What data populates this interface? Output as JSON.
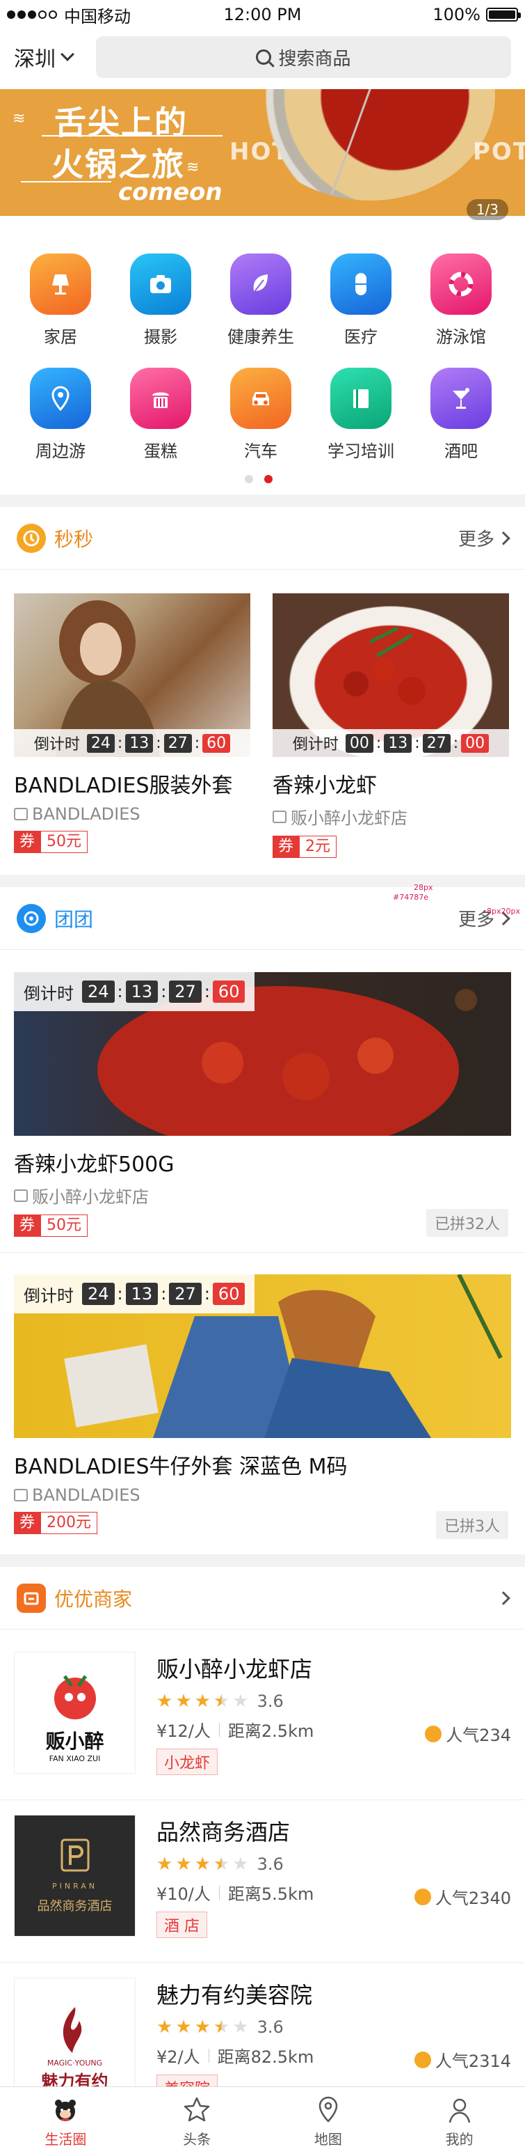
{
  "status_bar": {
    "carrier": "中国移动",
    "time": "12:00 PM",
    "battery": "100%"
  },
  "header": {
    "city": "深圳",
    "search_placeholder": "搜索商品"
  },
  "banner": {
    "line1": "舌尖上的",
    "line2": "火锅之旅",
    "line3": "comeon",
    "bg_left": "HOT",
    "bg_right": "POT",
    "pager": "1/3"
  },
  "categories": [
    {
      "label": "家居",
      "icon": "lamp-icon",
      "color": "#f7941d"
    },
    {
      "label": "摄影",
      "icon": "camera-icon",
      "color": "#1ca0e0"
    },
    {
      "label": "健康养生",
      "icon": "leaf-icon",
      "color": "#8a5cf0"
    },
    {
      "label": "医疗",
      "icon": "capsule-icon",
      "color": "#1e8ff0"
    },
    {
      "label": "游泳馆",
      "icon": "lifebuoy-icon",
      "color": "#ef3f86"
    },
    {
      "label": "周边游",
      "icon": "location-pin-icon",
      "color": "#1e8ff0"
    },
    {
      "label": "蛋糕",
      "icon": "cake-icon",
      "color": "#ef3f86"
    },
    {
      "label": "汽车",
      "icon": "car-icon",
      "color": "#f7941d"
    },
    {
      "label": "学习培训",
      "icon": "book-icon",
      "color": "#14c08c"
    },
    {
      "label": "酒吧",
      "icon": "cocktail-icon",
      "color": "#8a5cf0"
    }
  ],
  "flash_sale": {
    "title": "秒秒",
    "more": "更多",
    "items": [
      {
        "countdown_label": "倒计时",
        "h": "24",
        "m": "13",
        "s": "27",
        "ms": "60",
        "title": "BANDLADIES服装外套",
        "shop": "BANDLADIES",
        "coupon_tag": "券",
        "coupon": "50元"
      },
      {
        "countdown_label": "倒计时",
        "h": "00",
        "m": "13",
        "s": "27",
        "ms": "00",
        "title": "香辣小龙虾",
        "shop": "贩小醉小龙虾店",
        "coupon_tag": "券",
        "coupon": "2元"
      }
    ]
  },
  "annotation": {
    "a": "28px",
    "b": "#74787e",
    "c": "8px20px"
  },
  "group_buy": {
    "title": "团团",
    "more": "更多",
    "items": [
      {
        "countdown_label": "倒计时",
        "h": "24",
        "m": "13",
        "s": "27",
        "ms": "60",
        "title": "香辣小龙虾500G",
        "shop": "贩小醉小龙虾店",
        "coupon_tag": "券",
        "coupon": "50元",
        "joined": "已拼32人"
      },
      {
        "countdown_label": "倒计时",
        "h": "24",
        "m": "13",
        "s": "27",
        "ms": "60",
        "title": "BANDLADIES牛仔外套 深蓝色 M码",
        "shop": "BANDLADIES",
        "coupon_tag": "券",
        "coupon": "200元",
        "joined": "已拼3人"
      }
    ]
  },
  "merchants": {
    "title": "优优商家",
    "items": [
      {
        "name": "贩小醉小龙虾店",
        "rating": 3.6,
        "rating_text": "3.6",
        "price": "¥12/人",
        "distance": "距离2.5km",
        "popularity": "人气234",
        "tag": "小龙虾",
        "logo_text": "贩小醉",
        "logo_sub": "FAN XIAO ZUI"
      },
      {
        "name": "品然商务酒店",
        "rating": 3.6,
        "rating_text": "3.6",
        "price": "¥10/人",
        "distance": "距离5.5km",
        "popularity": "人气2340",
        "tag": "酒 店",
        "logo_text": "品然商务酒店",
        "logo_sub": "PINRAN"
      },
      {
        "name": "魅力有约美容院",
        "rating": 3.6,
        "rating_text": "3.6",
        "price": "¥2/人",
        "distance": "距离82.5km",
        "popularity": "人气2314",
        "tag": "美容院",
        "logo_text": "魅力有约",
        "logo_sub": "MAGIC·YOUNG"
      }
    ]
  },
  "tabbar": [
    {
      "label": "生活圈",
      "active": true
    },
    {
      "label": "头条",
      "active": false
    },
    {
      "label": "地图",
      "active": false
    },
    {
      "label": "我的",
      "active": false
    }
  ]
}
